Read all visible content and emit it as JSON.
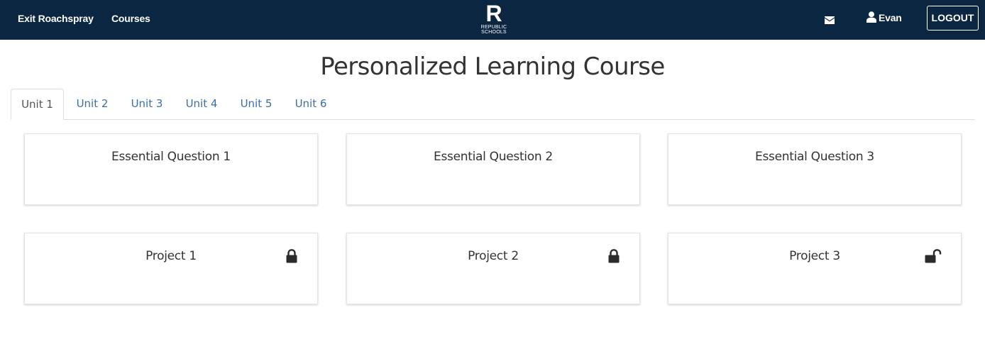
{
  "navbar": {
    "exit_label": "Exit Roachspray",
    "courses_label": "Courses",
    "logo_letter": "R",
    "logo_line1": "REPUBLIC",
    "logo_line2": "SCHOOLS",
    "mail_icon": "envelope-icon",
    "user_icon": "user-icon",
    "user_name": "Evan",
    "logout_label": "LOGOUT"
  },
  "page": {
    "title": "Personalized Learning Course"
  },
  "tabs": [
    {
      "label": "Unit 1",
      "active": true
    },
    {
      "label": "Unit 2",
      "active": false
    },
    {
      "label": "Unit 3",
      "active": false
    },
    {
      "label": "Unit 4",
      "active": false
    },
    {
      "label": "Unit 5",
      "active": false
    },
    {
      "label": "Unit 6",
      "active": false
    }
  ],
  "essential_questions": [
    {
      "title": "Essential Question 1"
    },
    {
      "title": "Essential Question 2"
    },
    {
      "title": "Essential Question 3"
    }
  ],
  "projects": [
    {
      "title": "Project 1",
      "lock_icon": "lock-icon",
      "locked": true
    },
    {
      "title": "Project 2",
      "lock_icon": "lock-icon",
      "locked": true
    },
    {
      "title": "Project 3",
      "lock_icon": "unlock-icon",
      "locked": false
    }
  ],
  "colors": {
    "navbar_bg": "#0b2640",
    "tab_link": "#3d6ea5",
    "text": "#333333"
  }
}
